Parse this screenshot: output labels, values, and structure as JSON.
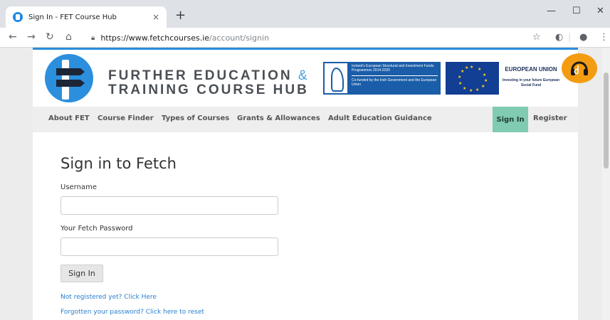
{
  "browser": {
    "tab_title": "Sign In - FET Course Hub",
    "tab_close": "×",
    "new_tab": "+",
    "url_host": "https://www.fetchcourses.ie",
    "url_path": "/account/signin",
    "window_controls": [
      "—",
      "☐",
      "✕"
    ]
  },
  "site": {
    "logo_line1": "FURTHER EDUCATION",
    "logo_amp": "&",
    "logo_line2": "TRAINING COURSE HUB",
    "esif_text_1": "Ireland's European Structural and Investment Funds Programmes 2014-2020",
    "esif_text_2": "Co-funded by the Irish Government and the European Union",
    "eu_title": "EUROPEAN UNION",
    "eu_subtitle": "Investing in your future European Social Fund"
  },
  "nav": {
    "items": [
      "About FET",
      "Course Finder",
      "Types of Courses",
      "Grants & Allowances",
      "Adult Education Guidance"
    ],
    "signin": "Sign In",
    "register": "Register"
  },
  "form": {
    "title": "Sign in to Fetch",
    "username_label": "Username",
    "username_value": "",
    "password_label": "Your Fetch Password",
    "password_value": "",
    "submit": "Sign In",
    "register_link": "Not registered yet? Click Here",
    "forgot_link": "Forgotten your password? Click here to reset"
  },
  "colors": {
    "accent": "#2a8ddb",
    "nav_active": "#80cbb1",
    "link": "#2a7fcf"
  }
}
